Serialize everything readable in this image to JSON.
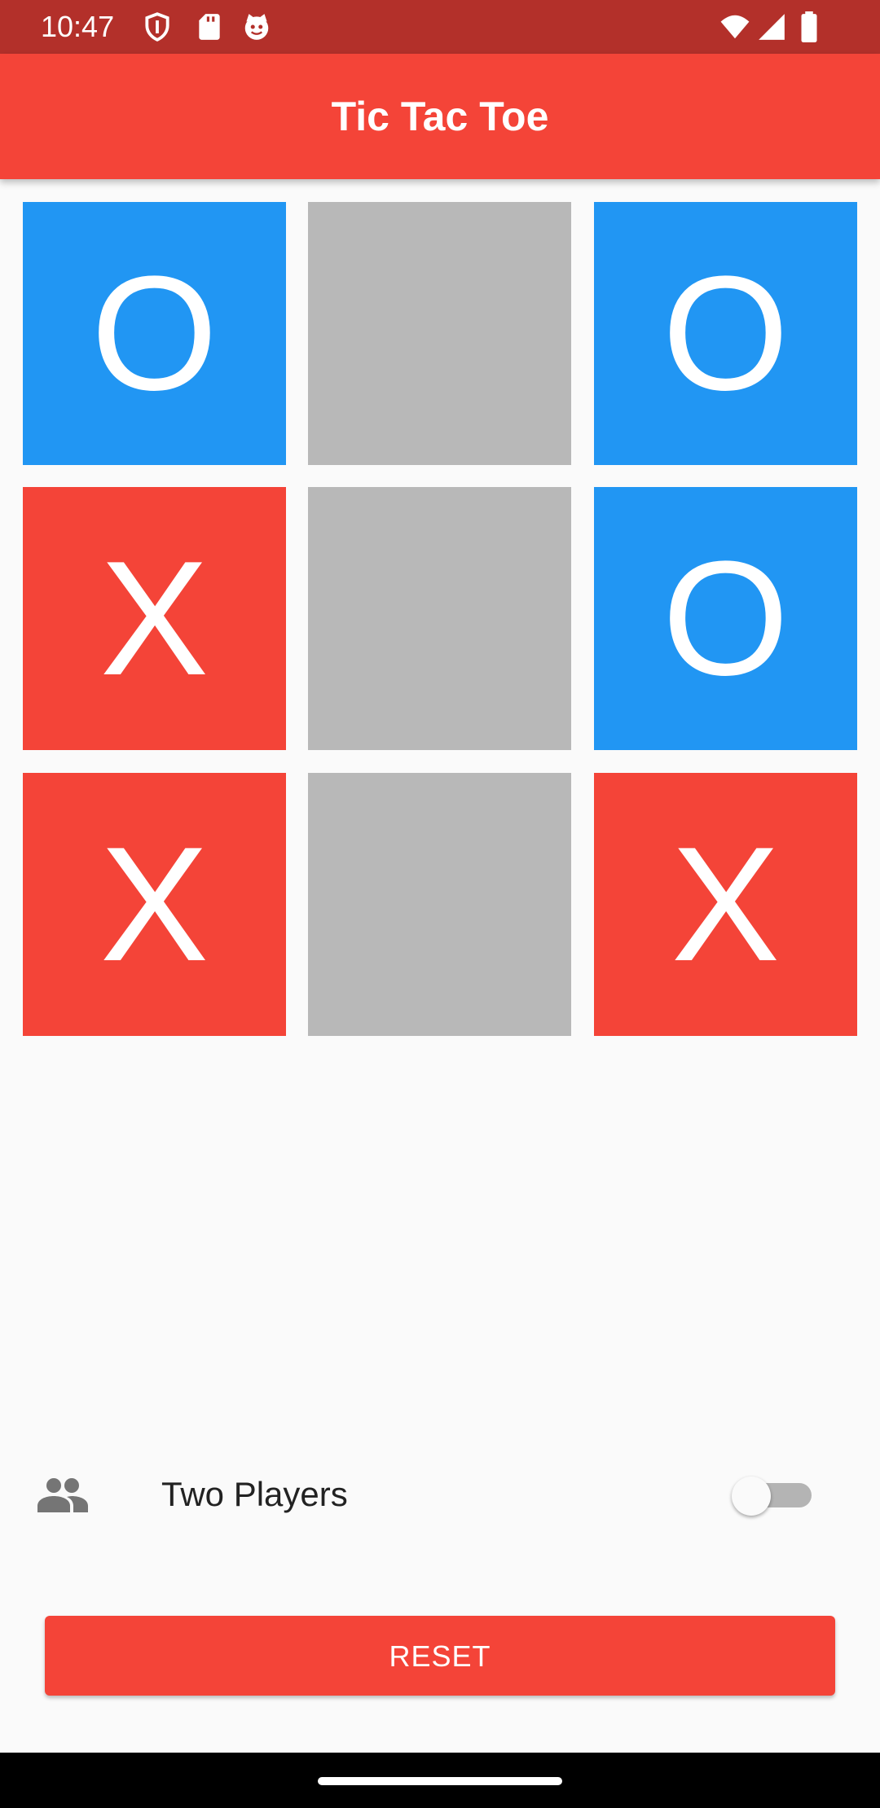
{
  "status_bar": {
    "time": "10:47",
    "left_icons": [
      "shield-icon",
      "sd-card-icon",
      "cat-icon"
    ],
    "right_icons": [
      "wifi-icon",
      "signal-icon",
      "battery-icon"
    ],
    "color": "#b3302a"
  },
  "app_bar": {
    "title": "Tic Tac Toe",
    "color": "#f44438"
  },
  "board": {
    "cells": [
      {
        "mark": "O"
      },
      {
        "mark": ""
      },
      {
        "mark": "O"
      },
      {
        "mark": "X"
      },
      {
        "mark": ""
      },
      {
        "mark": "O"
      },
      {
        "mark": "X"
      },
      {
        "mark": ""
      },
      {
        "mark": "X"
      }
    ],
    "colors": {
      "O": "#2196f3",
      "X": "#f44438",
      "empty": "#b8b8b8"
    }
  },
  "options": {
    "two_players_icon": "people-icon",
    "two_players_label": "Two Players",
    "two_players_enabled": false
  },
  "actions": {
    "reset_label": "RESET"
  }
}
